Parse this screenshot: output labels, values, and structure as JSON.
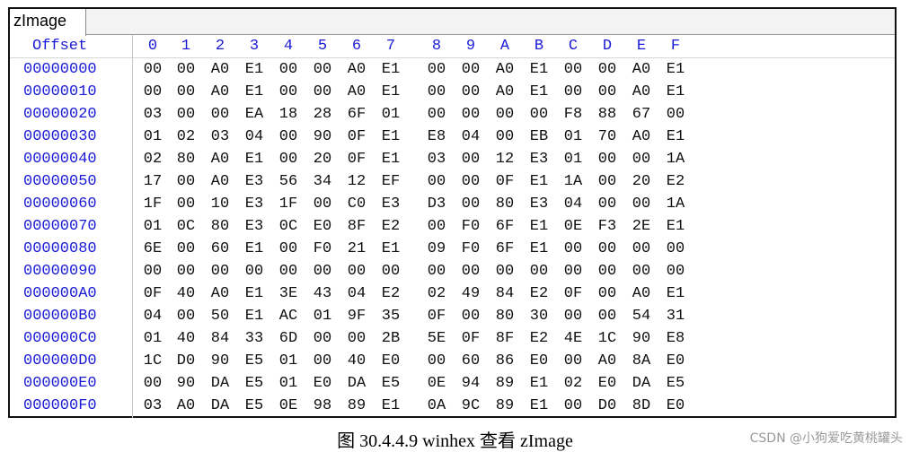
{
  "tab": {
    "label": "zImage"
  },
  "header": {
    "offset_label": "Offset",
    "columns": [
      "0",
      "1",
      "2",
      "3",
      "4",
      "5",
      "6",
      "7",
      "8",
      "9",
      "A",
      "B",
      "C",
      "D",
      "E",
      "F"
    ]
  },
  "rows": [
    {
      "offset": "00000000",
      "bytes": [
        "00",
        "00",
        "A0",
        "E1",
        "00",
        "00",
        "A0",
        "E1",
        "00",
        "00",
        "A0",
        "E1",
        "00",
        "00",
        "A0",
        "E1"
      ]
    },
    {
      "offset": "00000010",
      "bytes": [
        "00",
        "00",
        "A0",
        "E1",
        "00",
        "00",
        "A0",
        "E1",
        "00",
        "00",
        "A0",
        "E1",
        "00",
        "00",
        "A0",
        "E1"
      ]
    },
    {
      "offset": "00000020",
      "bytes": [
        "03",
        "00",
        "00",
        "EA",
        "18",
        "28",
        "6F",
        "01",
        "00",
        "00",
        "00",
        "00",
        "F8",
        "88",
        "67",
        "00"
      ]
    },
    {
      "offset": "00000030",
      "bytes": [
        "01",
        "02",
        "03",
        "04",
        "00",
        "90",
        "0F",
        "E1",
        "E8",
        "04",
        "00",
        "EB",
        "01",
        "70",
        "A0",
        "E1"
      ]
    },
    {
      "offset": "00000040",
      "bytes": [
        "02",
        "80",
        "A0",
        "E1",
        "00",
        "20",
        "0F",
        "E1",
        "03",
        "00",
        "12",
        "E3",
        "01",
        "00",
        "00",
        "1A"
      ]
    },
    {
      "offset": "00000050",
      "bytes": [
        "17",
        "00",
        "A0",
        "E3",
        "56",
        "34",
        "12",
        "EF",
        "00",
        "00",
        "0F",
        "E1",
        "1A",
        "00",
        "20",
        "E2"
      ]
    },
    {
      "offset": "00000060",
      "bytes": [
        "1F",
        "00",
        "10",
        "E3",
        "1F",
        "00",
        "C0",
        "E3",
        "D3",
        "00",
        "80",
        "E3",
        "04",
        "00",
        "00",
        "1A"
      ]
    },
    {
      "offset": "00000070",
      "bytes": [
        "01",
        "0C",
        "80",
        "E3",
        "0C",
        "E0",
        "8F",
        "E2",
        "00",
        "F0",
        "6F",
        "E1",
        "0E",
        "F3",
        "2E",
        "E1"
      ]
    },
    {
      "offset": "00000080",
      "bytes": [
        "6E",
        "00",
        "60",
        "E1",
        "00",
        "F0",
        "21",
        "E1",
        "09",
        "F0",
        "6F",
        "E1",
        "00",
        "00",
        "00",
        "00"
      ]
    },
    {
      "offset": "00000090",
      "bytes": [
        "00",
        "00",
        "00",
        "00",
        "00",
        "00",
        "00",
        "00",
        "00",
        "00",
        "00",
        "00",
        "00",
        "00",
        "00",
        "00"
      ]
    },
    {
      "offset": "000000A0",
      "bytes": [
        "0F",
        "40",
        "A0",
        "E1",
        "3E",
        "43",
        "04",
        "E2",
        "02",
        "49",
        "84",
        "E2",
        "0F",
        "00",
        "A0",
        "E1"
      ]
    },
    {
      "offset": "000000B0",
      "bytes": [
        "04",
        "00",
        "50",
        "E1",
        "AC",
        "01",
        "9F",
        "35",
        "0F",
        "00",
        "80",
        "30",
        "00",
        "00",
        "54",
        "31"
      ]
    },
    {
      "offset": "000000C0",
      "bytes": [
        "01",
        "40",
        "84",
        "33",
        "6D",
        "00",
        "00",
        "2B",
        "5E",
        "0F",
        "8F",
        "E2",
        "4E",
        "1C",
        "90",
        "E8"
      ]
    },
    {
      "offset": "000000D0",
      "bytes": [
        "1C",
        "D0",
        "90",
        "E5",
        "01",
        "00",
        "40",
        "E0",
        "00",
        "60",
        "86",
        "E0",
        "00",
        "A0",
        "8A",
        "E0"
      ]
    },
    {
      "offset": "000000E0",
      "bytes": [
        "00",
        "90",
        "DA",
        "E5",
        "01",
        "E0",
        "DA",
        "E5",
        "0E",
        "94",
        "89",
        "E1",
        "02",
        "E0",
        "DA",
        "E5"
      ]
    },
    {
      "offset": "000000F0",
      "bytes": [
        "03",
        "A0",
        "DA",
        "E5",
        "0E",
        "98",
        "89",
        "E1",
        "0A",
        "9C",
        "89",
        "E1",
        "00",
        "D0",
        "8D",
        "E0"
      ]
    }
  ],
  "caption": "图 30.4.4.9 winhex 查看 zImage",
  "watermark": "CSDN @小狗爱吃黄桃罐头",
  "colors": {
    "offset_blue": "#1a1ad6",
    "byte_text": "#111111"
  }
}
